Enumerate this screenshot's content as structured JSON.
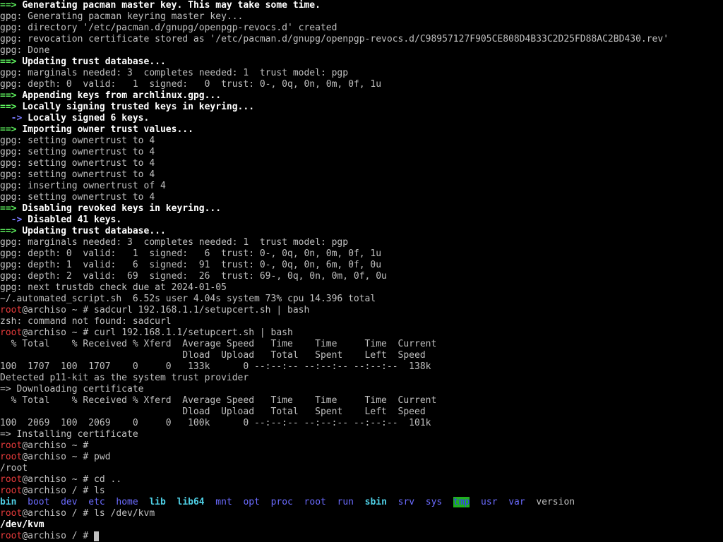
{
  "terminal": {
    "lines": [
      [
        {
          "t": "==> ",
          "c": "green"
        },
        {
          "t": "Generating pacman master key. This may take some time.",
          "c": "bold"
        }
      ],
      [
        {
          "t": "gpg: Generating pacman keyring master key...",
          "c": "default"
        }
      ],
      [
        {
          "t": "gpg: directory '/etc/pacman.d/gnupg/openpgp-revocs.d' created",
          "c": "default"
        }
      ],
      [
        {
          "t": "gpg: revocation certificate stored as '/etc/pacman.d/gnupg/openpgp-revocs.d/C98957127F905CE808D4B33C2D25FD88AC2BD430.rev'",
          "c": "default"
        }
      ],
      [
        {
          "t": "gpg: Done",
          "c": "default"
        }
      ],
      [
        {
          "t": "==> ",
          "c": "green"
        },
        {
          "t": "Updating trust database...",
          "c": "bold"
        }
      ],
      [
        {
          "t": "gpg: marginals needed: 3  completes needed: 1  trust model: pgp",
          "c": "default"
        }
      ],
      [
        {
          "t": "gpg: depth: 0  valid:   1  signed:   0  trust: 0-, 0q, 0n, 0m, 0f, 1u",
          "c": "default"
        }
      ],
      [
        {
          "t": "==> ",
          "c": "green"
        },
        {
          "t": "Appending keys from archlinux.gpg...",
          "c": "bold"
        }
      ],
      [
        {
          "t": "==> ",
          "c": "green"
        },
        {
          "t": "Locally signing trusted keys in keyring...",
          "c": "bold"
        }
      ],
      [
        {
          "t": "  -> ",
          "c": "blue-b"
        },
        {
          "t": "Locally signed 6 keys.",
          "c": "bold"
        }
      ],
      [
        {
          "t": "==> ",
          "c": "green"
        },
        {
          "t": "Importing owner trust values...",
          "c": "bold"
        }
      ],
      [
        {
          "t": "gpg: setting ownertrust to 4",
          "c": "default"
        }
      ],
      [
        {
          "t": "gpg: setting ownertrust to 4",
          "c": "default"
        }
      ],
      [
        {
          "t": "gpg: setting ownertrust to 4",
          "c": "default"
        }
      ],
      [
        {
          "t": "gpg: setting ownertrust to 4",
          "c": "default"
        }
      ],
      [
        {
          "t": "gpg: inserting ownertrust of 4",
          "c": "default"
        }
      ],
      [
        {
          "t": "gpg: setting ownertrust to 4",
          "c": "default"
        }
      ],
      [
        {
          "t": "==> ",
          "c": "green"
        },
        {
          "t": "Disabling revoked keys in keyring...",
          "c": "bold"
        }
      ],
      [
        {
          "t": "  -> ",
          "c": "blue-b"
        },
        {
          "t": "Disabled 41 keys.",
          "c": "bold"
        }
      ],
      [
        {
          "t": "==> ",
          "c": "green"
        },
        {
          "t": "Updating trust database...",
          "c": "bold"
        }
      ],
      [
        {
          "t": "gpg: marginals needed: 3  completes needed: 1  trust model: pgp",
          "c": "default"
        }
      ],
      [
        {
          "t": "gpg: depth: 0  valid:   1  signed:   6  trust: 0-, 0q, 0n, 0m, 0f, 1u",
          "c": "default"
        }
      ],
      [
        {
          "t": "gpg: depth: 1  valid:   6  signed:  91  trust: 0-, 0q, 0n, 6m, 0f, 0u",
          "c": "default"
        }
      ],
      [
        {
          "t": "gpg: depth: 2  valid:  69  signed:  26  trust: 69-, 0q, 0n, 0m, 0f, 0u",
          "c": "default"
        }
      ],
      [
        {
          "t": "gpg: next trustdb check due at 2024-01-05",
          "c": "default"
        }
      ],
      [
        {
          "t": "~/.automated_script.sh  6.52s user 4.04s system 73% cpu 14.396 total",
          "c": "default"
        }
      ],
      [
        {
          "t": "root",
          "c": "red"
        },
        {
          "t": "@archiso ~ # sadcurl 192.168.1.1/setupcert.sh | bash",
          "c": "default"
        }
      ],
      [
        {
          "t": "zsh: command not found: sadcurl",
          "c": "default"
        }
      ],
      [
        {
          "t": "root",
          "c": "red"
        },
        {
          "t": "@archiso ~ # curl 192.168.1.1/setupcert.sh | bash",
          "c": "default"
        }
      ],
      [
        {
          "t": "  % Total    % Received % Xferd  Average Speed   Time    Time     Time  Current",
          "c": "default"
        }
      ],
      [
        {
          "t": "                                 Dload  Upload   Total   Spent    Left  Speed",
          "c": "default"
        }
      ],
      [
        {
          "t": "100  1707  100  1707    0     0   133k      0 --:--:-- --:--:-- --:--:--  138k",
          "c": "default"
        }
      ],
      [
        {
          "t": "Detected p11-kit as the system trust provider",
          "c": "default"
        }
      ],
      [
        {
          "t": "=> Downloading certificate",
          "c": "default"
        }
      ],
      [
        {
          "t": "  % Total    % Received % Xferd  Average Speed   Time    Time     Time  Current",
          "c": "default"
        }
      ],
      [
        {
          "t": "                                 Dload  Upload   Total   Spent    Left  Speed",
          "c": "default"
        }
      ],
      [
        {
          "t": "100  2069  100  2069    0     0   100k      0 --:--:-- --:--:-- --:--:--  101k",
          "c": "default"
        }
      ],
      [
        {
          "t": "=> Installing certificate",
          "c": "default"
        }
      ],
      [
        {
          "t": "root",
          "c": "red"
        },
        {
          "t": "@archiso ~ #",
          "c": "default"
        }
      ],
      [
        {
          "t": "root",
          "c": "red"
        },
        {
          "t": "@archiso ~ # pwd",
          "c": "default"
        }
      ],
      [
        {
          "t": "/root",
          "c": "default"
        }
      ],
      [
        {
          "t": "root",
          "c": "red"
        },
        {
          "t": "@archiso ~ # cd ..",
          "c": "default"
        }
      ],
      [
        {
          "t": "root",
          "c": "red"
        },
        {
          "t": "@archiso / # ls",
          "c": "default"
        }
      ],
      [
        {
          "t": "bin",
          "c": "cyan"
        },
        {
          "t": "  ",
          "c": "default"
        },
        {
          "t": "boot",
          "c": "blue"
        },
        {
          "t": "  ",
          "c": "default"
        },
        {
          "t": "dev",
          "c": "blue"
        },
        {
          "t": "  ",
          "c": "default"
        },
        {
          "t": "etc",
          "c": "blue"
        },
        {
          "t": "  ",
          "c": "default"
        },
        {
          "t": "home",
          "c": "blue"
        },
        {
          "t": "  ",
          "c": "default"
        },
        {
          "t": "lib",
          "c": "cyan"
        },
        {
          "t": "  ",
          "c": "default"
        },
        {
          "t": "lib64",
          "c": "cyan"
        },
        {
          "t": "  ",
          "c": "default"
        },
        {
          "t": "mnt",
          "c": "blue"
        },
        {
          "t": "  ",
          "c": "default"
        },
        {
          "t": "opt",
          "c": "blue"
        },
        {
          "t": "  ",
          "c": "default"
        },
        {
          "t": "proc",
          "c": "blue"
        },
        {
          "t": "  ",
          "c": "default"
        },
        {
          "t": "root",
          "c": "blue"
        },
        {
          "t": "  ",
          "c": "default"
        },
        {
          "t": "run",
          "c": "blue"
        },
        {
          "t": "  ",
          "c": "default"
        },
        {
          "t": "sbin",
          "c": "cyan"
        },
        {
          "t": "  ",
          "c": "default"
        },
        {
          "t": "srv",
          "c": "blue"
        },
        {
          "t": "  ",
          "c": "default"
        },
        {
          "t": "sys",
          "c": "blue"
        },
        {
          "t": "  ",
          "c": "default"
        },
        {
          "t": "tmp",
          "c": "tmp"
        },
        {
          "t": "  ",
          "c": "default"
        },
        {
          "t": "usr",
          "c": "blue"
        },
        {
          "t": "  ",
          "c": "default"
        },
        {
          "t": "var",
          "c": "blue"
        },
        {
          "t": "  ",
          "c": "default"
        },
        {
          "t": "version",
          "c": "default"
        }
      ],
      [
        {
          "t": "root",
          "c": "red"
        },
        {
          "t": "@archiso / # ls /dev/kvm",
          "c": "default"
        }
      ],
      [
        {
          "t": "/dev/kvm",
          "c": "bold"
        }
      ],
      [
        {
          "t": "root",
          "c": "red"
        },
        {
          "t": "@archiso / # ",
          "c": "default"
        }
      ]
    ],
    "colors": {
      "background": "#000000",
      "text": "#c0c0c0",
      "arrow": "#5ef25e",
      "root_prompt": "#e63b3b",
      "directory": "#6b6bff",
      "symlink": "#4fd0e6"
    }
  }
}
